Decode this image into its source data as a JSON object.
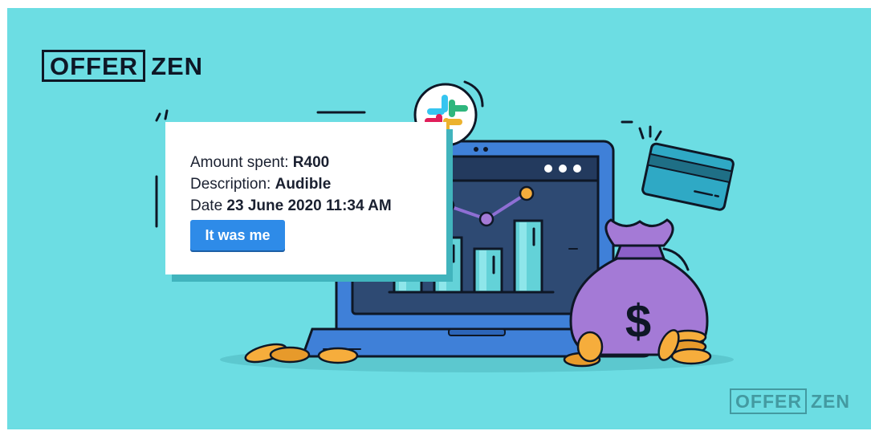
{
  "brand": {
    "logo_boxed": "OFFER",
    "logo_plain": "ZEN",
    "watermark_boxed": "OFFER",
    "watermark_plain": "ZEN"
  },
  "notification": {
    "amount_label": "Amount spent: ",
    "amount_value": "R400",
    "description_label": "Description: ",
    "description_value": "Audible",
    "date_label": "Date ",
    "date_value": "23 June 2020 11:34 AM",
    "button_label": "It was me"
  },
  "illustration": {
    "bar_levels": [
      0.42,
      0.63,
      0.5,
      0.82
    ],
    "line_markers": [
      "purple",
      "orange",
      "purple",
      "orange"
    ]
  },
  "colors": {
    "background": "#6cdde3",
    "laptop_blue": "#3f80d8",
    "screen_navy": "#2e4a73",
    "bars_teal": "#63d2d8",
    "accent_orange": "#f6ad3c",
    "bag_purple": "#a47ad6",
    "button_blue": "#2e8be8",
    "outline": "#0e1726"
  },
  "icons": [
    "slack-icon",
    "credit-card-icon",
    "money-bag-icon",
    "dollar-sign-icon",
    "coin-icon",
    "laptop-icon"
  ]
}
